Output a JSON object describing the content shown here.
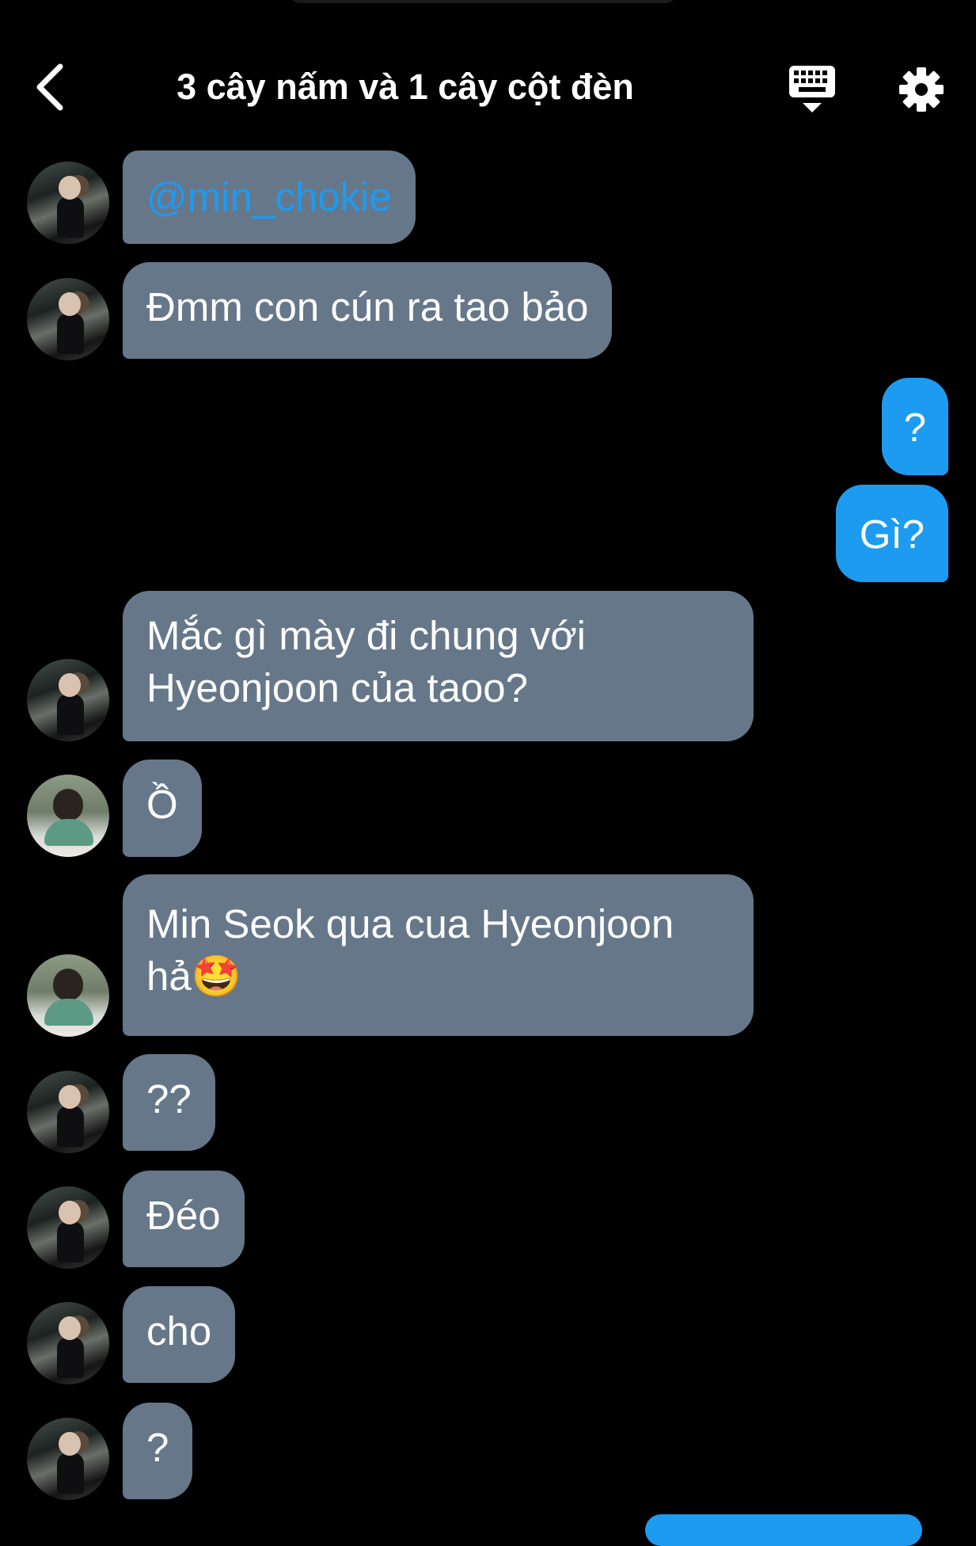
{
  "header": {
    "title": "3 cây nấm và 1 cây cột đèn",
    "back_icon": "chevron-left-icon",
    "keyboard_icon": "keyboard-icon",
    "settings_icon": "gear-icon"
  },
  "colors": {
    "background": "#000000",
    "incoming_bubble": "#66778a",
    "outgoing_bubble": "#1d9bf0",
    "mention": "#1d9bf0"
  },
  "messages": [
    {
      "direction": "in",
      "avatar": "user-a",
      "text": "@min_chokie"
    },
    {
      "direction": "in",
      "avatar": "user-a",
      "text": "Đmm con cún ra tao bảo"
    },
    {
      "direction": "out",
      "text": "?"
    },
    {
      "direction": "out",
      "text": "Gì?"
    },
    {
      "direction": "in",
      "avatar": "user-a",
      "line1": "Mắc gì mày đi chung với",
      "line2": "Hyeonjoon của taoo?"
    },
    {
      "direction": "in",
      "avatar": "user-b",
      "text": "Ồ"
    },
    {
      "direction": "in",
      "avatar": "user-b",
      "line1": "Min Seok qua cua Hyeonjoon",
      "line2": "hả🤩"
    },
    {
      "direction": "in",
      "avatar": "user-a",
      "text": "??"
    },
    {
      "direction": "in",
      "avatar": "user-a",
      "text": "Đéo"
    },
    {
      "direction": "in",
      "avatar": "user-a",
      "text": "cho"
    },
    {
      "direction": "in",
      "avatar": "user-a",
      "text": "?"
    }
  ]
}
